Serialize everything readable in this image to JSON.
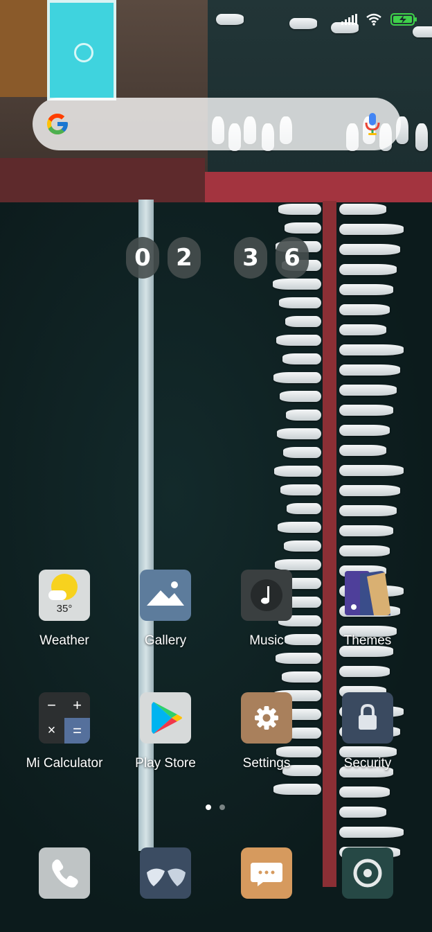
{
  "status_bar": {
    "icons": [
      "signal-icon",
      "wifi-icon",
      "battery-charging-icon"
    ],
    "battery_color": "#3fd14a"
  },
  "search": {
    "icons": [
      "google-g-icon",
      "mic-icon"
    ]
  },
  "clock": {
    "digits": [
      "0",
      "2",
      "3",
      "6"
    ]
  },
  "apps": [
    {
      "label": "Weather",
      "icon": "weather-icon",
      "temp": "35°"
    },
    {
      "label": "Gallery",
      "icon": "gallery-icon"
    },
    {
      "label": "Music",
      "icon": "music-icon"
    },
    {
      "label": "Themes",
      "icon": "themes-icon"
    },
    {
      "label": "Mi Calculator",
      "icon": "calculator-icon"
    },
    {
      "label": "Play Store",
      "icon": "play-store-icon"
    },
    {
      "label": "Settings",
      "icon": "settings-icon"
    },
    {
      "label": "Security",
      "icon": "security-icon"
    }
  ],
  "page_indicator": {
    "pages": 2,
    "current": 1
  },
  "dock": [
    {
      "icon": "phone-icon"
    },
    {
      "icon": "contacts-icon"
    },
    {
      "icon": "messages-icon"
    },
    {
      "icon": "camera-icon"
    }
  ]
}
